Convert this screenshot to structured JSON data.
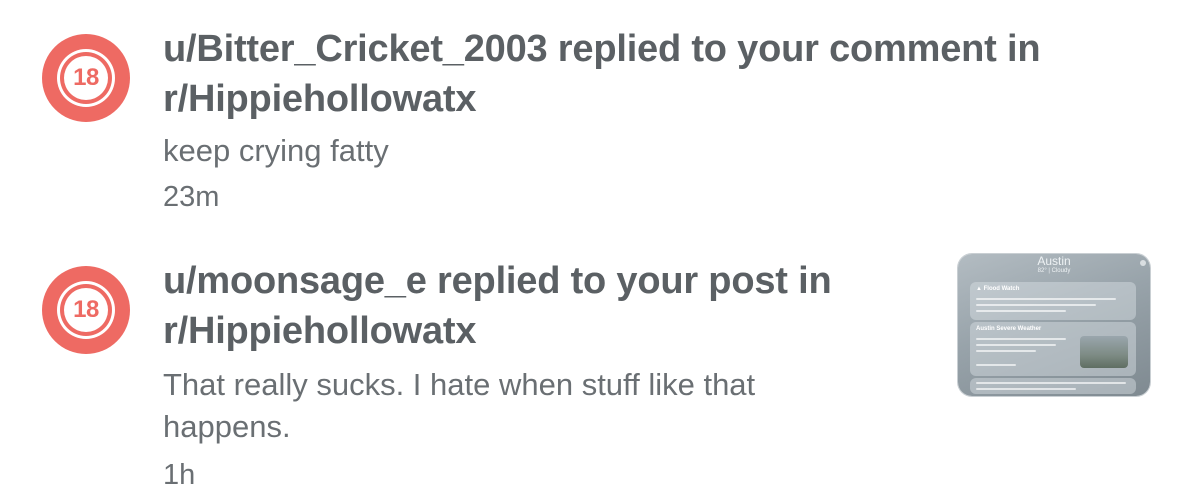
{
  "notifications": [
    {
      "avatar_badge": "18",
      "title": "u/Bitter_Cricket_2003 replied to your comment in r/Hippiehollowatx",
      "body": "keep crying fatty",
      "time": "23m"
    },
    {
      "avatar_badge": "18",
      "title": "u/moonsage_e replied to your post in r/Hippiehollowatx",
      "body": "That really sucks. I hate when stuff like that happens.",
      "time": "1h",
      "thumbnail": {
        "city": "Austin",
        "condition": "82° | Cloudy",
        "card_1_title": "▲ Flood Watch",
        "card_2_title": "Austin Severe Weather"
      }
    }
  ],
  "colors": {
    "avatar": "#ee6a63",
    "title": "#5b6064",
    "body": "#6a6f73"
  }
}
